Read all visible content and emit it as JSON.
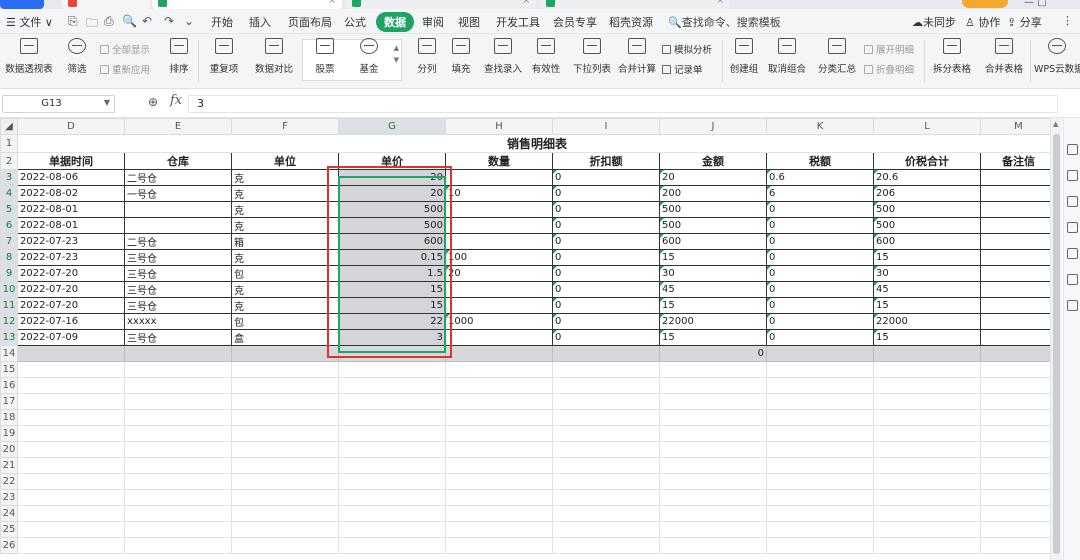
{
  "tabstrip": {
    "tabs": [
      {
        "label": "",
        "close": ""
      },
      {
        "label": "",
        "close": ""
      },
      {
        "label": "",
        "close": "×"
      },
      {
        "label": "",
        "close": "×"
      },
      {
        "label": "",
        "close": "×"
      }
    ],
    "tools": "— □"
  },
  "menubar": {
    "file_label": "☰ 文件 ∨",
    "quick_access": [
      "⎘",
      "🗀",
      "⎙",
      "🔍",
      "↶",
      "↷",
      "⌄"
    ],
    "items": [
      {
        "label": "开始"
      },
      {
        "label": "插入"
      },
      {
        "label": "页面布局"
      },
      {
        "label": "公式"
      },
      {
        "label": "数据",
        "active": true
      },
      {
        "label": "审阅"
      },
      {
        "label": "视图"
      },
      {
        "label": "开发工具"
      },
      {
        "label": "会员专享"
      },
      {
        "label": "稻壳资源"
      }
    ],
    "search_label": "🔍查找命令、搜索模板",
    "right": {
      "sync": "☁未同步",
      "collab": "♙ 协作",
      "share": "⇪ 分享",
      "more": "⋮"
    }
  },
  "ribbon": {
    "pivot_table": "数据透视表",
    "filter": "筛选",
    "show_all": "全部显示",
    "reapply": "重新应用",
    "sort": "排序",
    "duplicates": "重复项",
    "compare": "数据对比",
    "stock": "股票",
    "fund": "基金",
    "split_column": "分列",
    "fill": "填充",
    "find_entry": "查找录入",
    "validity": "有效性",
    "dropdown_list": "下拉列表",
    "consolidate": "合并计算",
    "simulation": "模拟分析",
    "record_form": "记录单",
    "create_group": "创建组",
    "ungroup": "取消组合",
    "subtotal": "分类汇总",
    "expand_detail": "展开明细",
    "collapse_detail": "折叠明细",
    "split_table": "拆分表格",
    "merge_table": "合并表格",
    "wps_cloud": "WPS云数据"
  },
  "formula": {
    "cell_ref": "G13",
    "fx": "fx",
    "value": "3"
  },
  "sheet": {
    "col_headers": [
      "D",
      "E",
      "F",
      "G",
      "H",
      "I",
      "J",
      "K",
      "L",
      "M"
    ],
    "title": "销售明细表",
    "headers": [
      "单据时间",
      "仓库",
      "单位",
      "单价",
      "数量",
      "折扣额",
      "金额",
      "税额",
      "价税合计",
      "备注信"
    ],
    "rows": [
      {
        "row": "3",
        "cells": [
          "2022-08-06",
          "二号仓",
          "克",
          "20",
          "",
          "0",
          "20",
          "0.6",
          "20.6",
          ""
        ]
      },
      {
        "row": "4",
        "cells": [
          "2022-08-02",
          "一号仓",
          "克",
          "20",
          "10",
          "0",
          "200",
          "6",
          "206",
          ""
        ]
      },
      {
        "row": "5",
        "cells": [
          "2022-08-01",
          "",
          "克",
          "500",
          "",
          "0",
          "500",
          "0",
          "500",
          ""
        ]
      },
      {
        "row": "6",
        "cells": [
          "2022-08-01",
          "",
          "克",
          "500",
          "",
          "0",
          "500",
          "0",
          "500",
          ""
        ]
      },
      {
        "row": "7",
        "cells": [
          "2022-07-23",
          "二号仓",
          "箱",
          "600",
          "",
          "0",
          "600",
          "0",
          "600",
          ""
        ]
      },
      {
        "row": "8",
        "cells": [
          "2022-07-23",
          "三号仓",
          "克",
          "0.15",
          "100",
          "0",
          "15",
          "0",
          "15",
          ""
        ]
      },
      {
        "row": "9",
        "cells": [
          "2022-07-20",
          "三号仓",
          "包",
          "1.5",
          "20",
          "0",
          "30",
          "0",
          "30",
          ""
        ]
      },
      {
        "row": "10",
        "cells": [
          "2022-07-20",
          "三号仓",
          "克",
          "15",
          "",
          "0",
          "45",
          "0",
          "45",
          ""
        ]
      },
      {
        "row": "11",
        "cells": [
          "2022-07-20",
          "三号仓",
          "克",
          "15",
          "",
          "0",
          "15",
          "0",
          "15",
          ""
        ]
      },
      {
        "row": "12",
        "cells": [
          "2022-07-16",
          "xxxxx",
          "包",
          "22",
          "1000",
          "0",
          "22000",
          "0",
          "22000",
          ""
        ]
      },
      {
        "row": "13",
        "cells": [
          "2022-07-09",
          "三号仓",
          "盒",
          "3",
          "",
          "0",
          "15",
          "0",
          "15",
          ""
        ]
      }
    ],
    "total_row": {
      "row": "14",
      "value": "0"
    },
    "empty_rows": [
      "15",
      "16",
      "17",
      "18",
      "19",
      "20",
      "21",
      "22",
      "23",
      "24",
      "25",
      "26"
    ],
    "selected_column": "G",
    "colors": {
      "accent_green": "#1fa463",
      "highlight_red": "#e0332b",
      "selected_fill": "#d3d5d8"
    }
  }
}
